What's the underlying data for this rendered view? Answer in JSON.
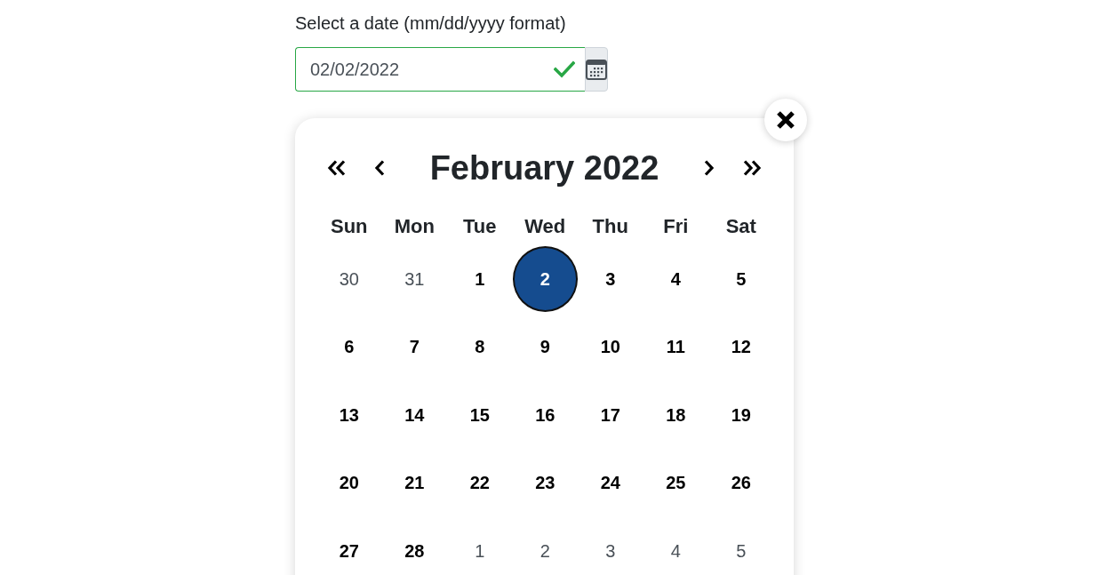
{
  "date_field": {
    "label": "Select a date (mm/dd/yyyy format)",
    "value": "02/02/2022",
    "valid": true
  },
  "calendar": {
    "title": "February 2022",
    "weekdays": [
      "Sun",
      "Mon",
      "Tue",
      "Wed",
      "Thu",
      "Fri",
      "Sat"
    ],
    "weeks": [
      [
        {
          "day": "30",
          "in_month": false,
          "selected": false
        },
        {
          "day": "31",
          "in_month": false,
          "selected": false
        },
        {
          "day": "1",
          "in_month": true,
          "selected": false
        },
        {
          "day": "2",
          "in_month": true,
          "selected": true
        },
        {
          "day": "3",
          "in_month": true,
          "selected": false
        },
        {
          "day": "4",
          "in_month": true,
          "selected": false
        },
        {
          "day": "5",
          "in_month": true,
          "selected": false
        }
      ],
      [
        {
          "day": "6",
          "in_month": true,
          "selected": false
        },
        {
          "day": "7",
          "in_month": true,
          "selected": false
        },
        {
          "day": "8",
          "in_month": true,
          "selected": false
        },
        {
          "day": "9",
          "in_month": true,
          "selected": false
        },
        {
          "day": "10",
          "in_month": true,
          "selected": false
        },
        {
          "day": "11",
          "in_month": true,
          "selected": false
        },
        {
          "day": "12",
          "in_month": true,
          "selected": false
        }
      ],
      [
        {
          "day": "13",
          "in_month": true,
          "selected": false
        },
        {
          "day": "14",
          "in_month": true,
          "selected": false
        },
        {
          "day": "15",
          "in_month": true,
          "selected": false
        },
        {
          "day": "16",
          "in_month": true,
          "selected": false
        },
        {
          "day": "17",
          "in_month": true,
          "selected": false
        },
        {
          "day": "18",
          "in_month": true,
          "selected": false
        },
        {
          "day": "19",
          "in_month": true,
          "selected": false
        }
      ],
      [
        {
          "day": "20",
          "in_month": true,
          "selected": false
        },
        {
          "day": "21",
          "in_month": true,
          "selected": false
        },
        {
          "day": "22",
          "in_month": true,
          "selected": false
        },
        {
          "day": "23",
          "in_month": true,
          "selected": false
        },
        {
          "day": "24",
          "in_month": true,
          "selected": false
        },
        {
          "day": "25",
          "in_month": true,
          "selected": false
        },
        {
          "day": "26",
          "in_month": true,
          "selected": false
        }
      ],
      [
        {
          "day": "27",
          "in_month": true,
          "selected": false
        },
        {
          "day": "28",
          "in_month": true,
          "selected": false
        },
        {
          "day": "1",
          "in_month": false,
          "selected": false
        },
        {
          "day": "2",
          "in_month": false,
          "selected": false
        },
        {
          "day": "3",
          "in_month": false,
          "selected": false
        },
        {
          "day": "4",
          "in_month": false,
          "selected": false
        },
        {
          "day": "5",
          "in_month": false,
          "selected": false
        }
      ]
    ]
  }
}
